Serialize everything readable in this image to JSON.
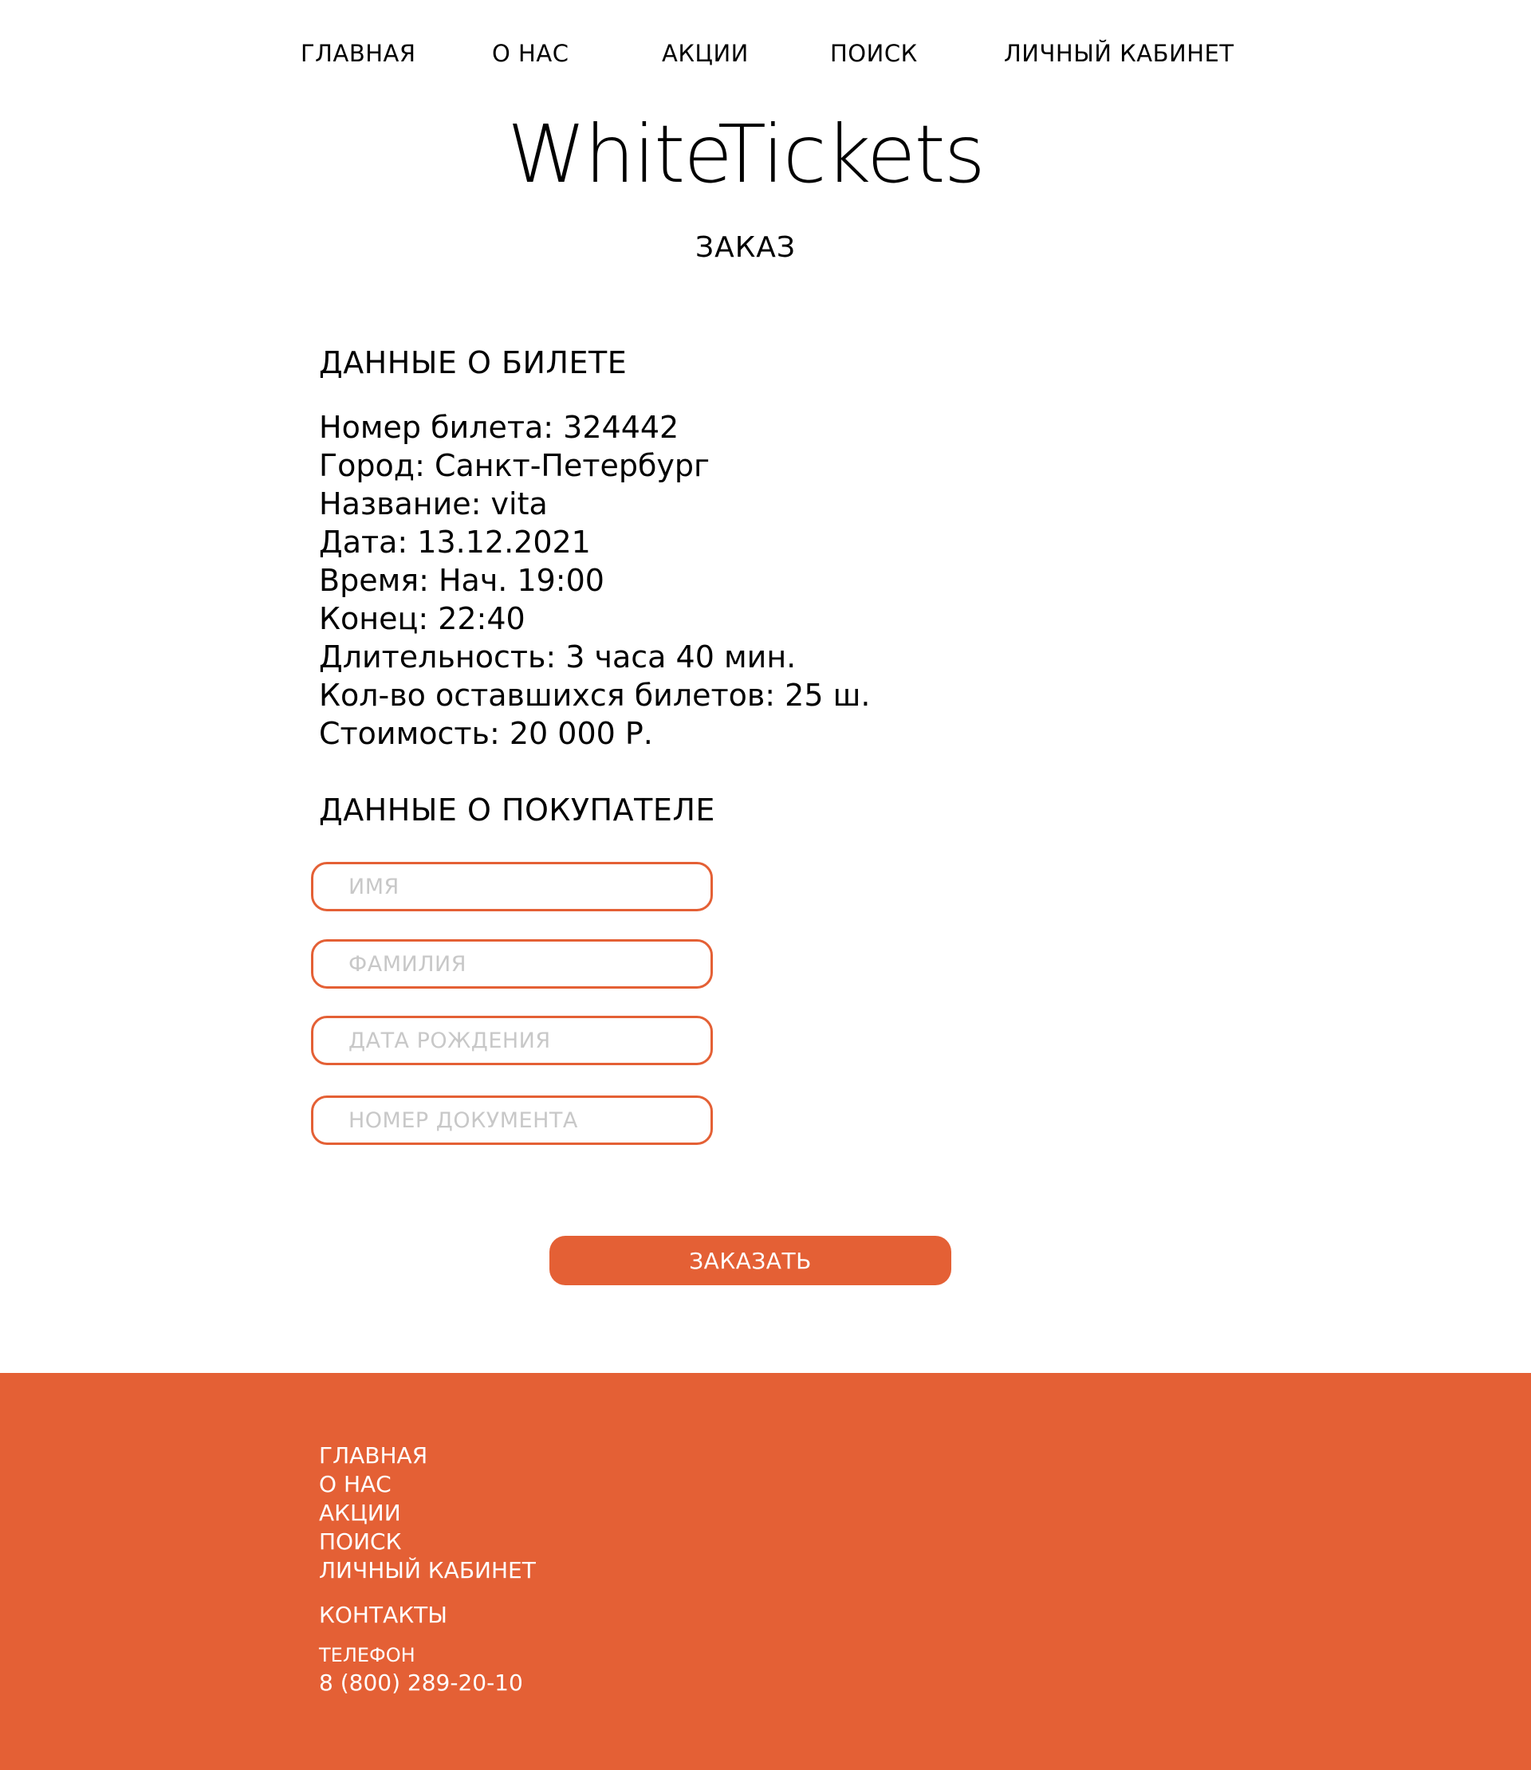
{
  "header": {
    "nav": [
      {
        "label": "ГЛАВНАЯ"
      },
      {
        "label": "О НАС"
      },
      {
        "label": "АКЦИИ"
      },
      {
        "label": "ПОИСК"
      },
      {
        "label": "ЛИЧНЫЙ КАБИНЕТ"
      }
    ],
    "logo": "WhiteTickets"
  },
  "page": {
    "title": "ЗАКАЗ"
  },
  "ticket": {
    "heading": "ДАННЫЕ О БИЛЕТЕ",
    "lines": [
      "Номер билета: 324442",
      "Город: Санкт-Петербург",
      "Название: vita",
      "Дата: 13.12.2021",
      "Время: Нач. 19:00",
      "Конец: 22:40",
      "Длительность: 3 часа 40 мин.",
      "Кол-во оставшихся билетов: 25 ш.",
      "Стоимость: 20 000 Р."
    ]
  },
  "buyer": {
    "heading": "ДАННЫЕ О ПОКУПАТЕЛЕ",
    "fields": [
      {
        "placeholder": "ИМЯ",
        "value": ""
      },
      {
        "placeholder": "ФАМИЛИЯ",
        "value": ""
      },
      {
        "placeholder": "ДАТА РОЖДЕНИЯ",
        "value": ""
      },
      {
        "placeholder": "НОМЕР ДОКУМЕНТА",
        "value": ""
      }
    ],
    "submit_label": "ЗАКАЗАТЬ"
  },
  "footer": {
    "nav": [
      {
        "label": "ГЛАВНАЯ"
      },
      {
        "label": "О НАС"
      },
      {
        "label": "АКЦИИ"
      },
      {
        "label": "ПОИСК"
      },
      {
        "label": "ЛИЧНЫЙ КАБИНЕТ"
      }
    ],
    "contacts_heading": "КОНТАКТЫ",
    "phone_label": "ТЕЛЕФОН",
    "phone": "8 (800) 289-20-10"
  },
  "colors": {
    "accent": "#e46035",
    "background": "#ffffff",
    "text": "#000000",
    "placeholder": "#c8c8c8"
  }
}
